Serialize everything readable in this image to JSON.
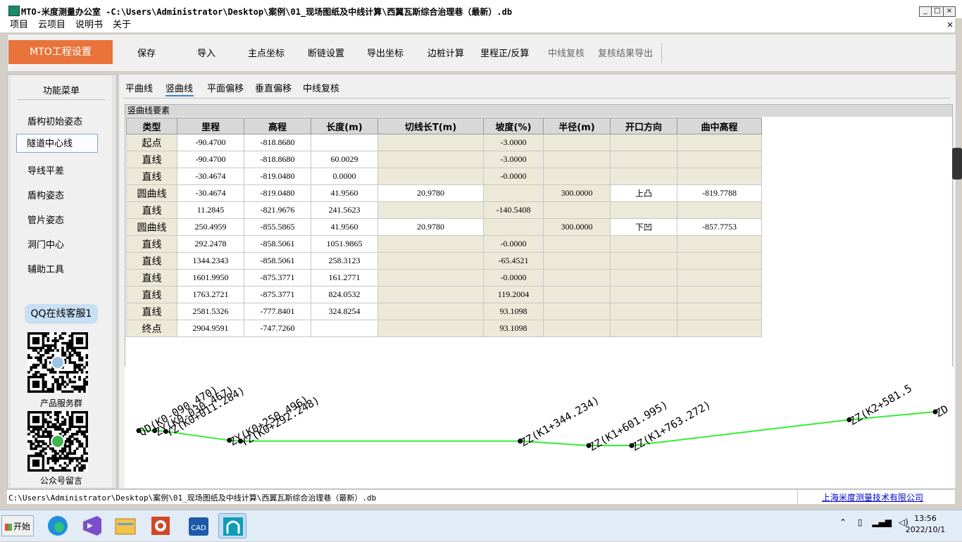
{
  "window": {
    "title": "MTO-米度测量办公室 -C:\\Users\\Administrator\\Desktop\\案例\\01_现场图纸及中线计算\\西翼瓦斯综合治理巷（最新）.db",
    "min_label": "_",
    "max_label": "□",
    "close_label": "×"
  },
  "menubar": {
    "items": [
      "项目",
      "云项目",
      "说明书",
      "关于"
    ],
    "close_label": "×"
  },
  "toolbar": {
    "mto_label": "MTO工程设置",
    "buttons": [
      "保存",
      "导入",
      "主点坐标",
      "断链设置",
      "导出坐标",
      "边桩计算",
      "里程正/反算",
      "中线复核",
      "复核结果导出"
    ]
  },
  "sidebar": {
    "title": "功能菜单",
    "items": [
      "盾构初始姿态",
      "隧道中心线",
      "导线平差",
      "盾构姿态",
      "管片姿态",
      "洞门中心",
      "辅助工具"
    ],
    "selected_index": 1,
    "qq_label": "QQ在线客服1",
    "qr1_caption": "产品服务群",
    "qr2_caption": "公众号留言"
  },
  "tabs": {
    "items": [
      "平曲线",
      "竖曲线",
      "平面偏移",
      "垂直偏移",
      "中线复核"
    ],
    "active_index": 1
  },
  "grid": {
    "caption": "竖曲线要素",
    "headers": [
      "类型",
      "里程",
      "高程",
      "长度(m)",
      "切线长T(m)",
      "坡度(%)",
      "半径(m)",
      "开口方向",
      "曲中高程"
    ],
    "rows": [
      [
        "起点",
        "-90.4700",
        "-818.8680",
        "",
        "",
        "-3.0000",
        "",
        "",
        ""
      ],
      [
        "直线",
        "-90.4700",
        "-818.8680",
        "60.0029",
        "",
        "-3.0000",
        "",
        "",
        ""
      ],
      [
        "直线",
        "-30.4674",
        "-819.0480",
        "0.0000",
        "",
        "-0.0000",
        "",
        "",
        ""
      ],
      [
        "圆曲线",
        "-30.4674",
        "-819.0480",
        "41.9560",
        "20.9780",
        "",
        "300.0000",
        "上凸",
        "-819.7788"
      ],
      [
        "直线",
        "11.2845",
        "-821.9676",
        "241.5623",
        "",
        "-140.5408",
        "",
        "",
        ""
      ],
      [
        "圆曲线",
        "250.4959",
        "-855.5865",
        "41.9560",
        "20.9780",
        "",
        "300.0000",
        "下凹",
        "-857.7753"
      ],
      [
        "直线",
        "292.2478",
        "-858.5061",
        "1051.9865",
        "",
        "-0.0000",
        "",
        "",
        ""
      ],
      [
        "直线",
        "1344.2343",
        "-858.5061",
        "258.3123",
        "",
        "-65.4521",
        "",
        "",
        ""
      ],
      [
        "直线",
        "1601.9950",
        "-875.3771",
        "161.2771",
        "",
        "-0.0000",
        "",
        "",
        ""
      ],
      [
        "直线",
        "1763.2721",
        "-875.3771",
        "824.0532",
        "",
        "119.2004",
        "",
        "",
        ""
      ],
      [
        "直线",
        "2581.5326",
        "-777.8401",
        "324.8254",
        "",
        "93.1098",
        "",
        "",
        ""
      ],
      [
        "终点",
        "2904.9591",
        "-747.7260",
        "",
        "",
        "93.1098",
        "",
        "",
        ""
      ]
    ]
  },
  "profile": {
    "line_color": "#33ee33",
    "labels": [
      "QD(K0-090.470)",
      "ZY(K0-030.467)",
      "YZ(K0+011.284)",
      "ZY(K0+250.496)",
      "YZ(K0+292.248)",
      "ZZ(K1+344.234)",
      "ZZ(K1+601.995)",
      "ZZ(K1+763.272)",
      "ZZ(K2+581.5",
      "ZD"
    ]
  },
  "statusbar": {
    "path": "C:\\Users\\Administrator\\Desktop\\案例\\01_现场图纸及中线计算\\西翼瓦斯综合治理巷（最新）.db",
    "company": "上海米度测量技术有限公司"
  },
  "taskbar": {
    "start_label": "开始",
    "time": "13:56",
    "date": "2022/10/1",
    "cad_label": "CAD"
  }
}
